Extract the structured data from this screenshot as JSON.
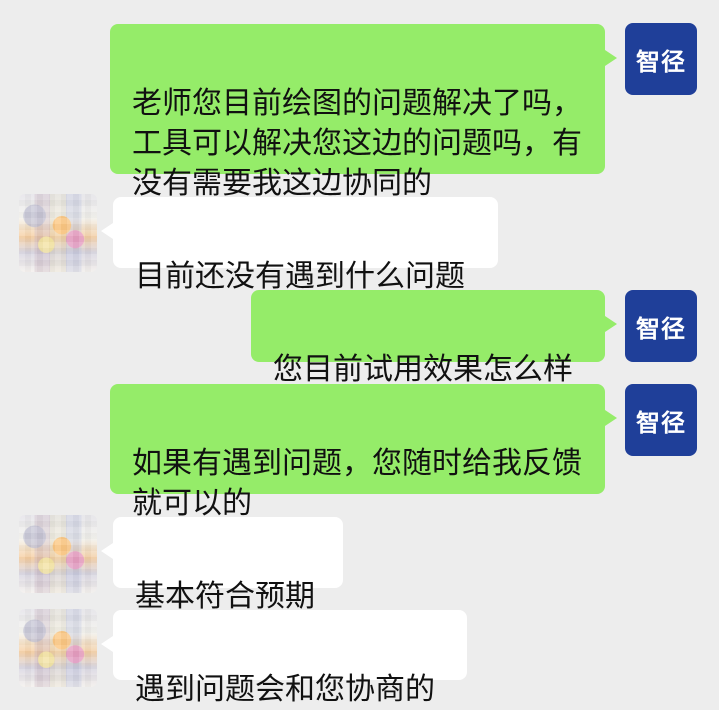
{
  "chat": {
    "self_avatar_text": "智径",
    "messages": [
      {
        "side": "right",
        "text": "老师您目前绘图的问题解决了吗，\n工具可以解决您这边的问题吗，有\n没有需要我这边协同的"
      },
      {
        "side": "left",
        "text": "目前还没有遇到什么问题"
      },
      {
        "side": "right",
        "text": "您目前试用效果怎么样"
      },
      {
        "side": "right",
        "text": "如果有遇到问题，您随时给我反馈\n就可以的"
      },
      {
        "side": "left",
        "text": "基本符合预期"
      },
      {
        "side": "left",
        "text": "遇到问题会和您协商的"
      }
    ]
  },
  "colors": {
    "background": "#ededed",
    "outgoing_bubble": "#95ec69",
    "incoming_bubble": "#ffffff",
    "self_avatar_bg": "#1f3f99"
  }
}
